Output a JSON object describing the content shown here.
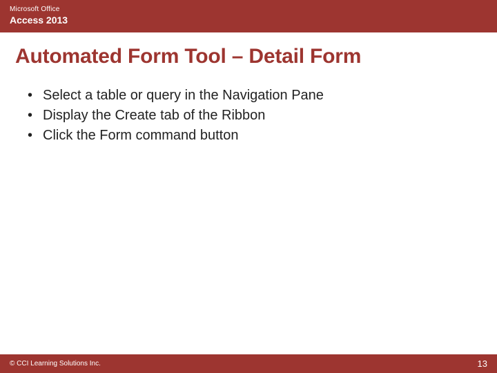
{
  "header": {
    "brand": "Microsoft Office",
    "product": "Access 2013"
  },
  "title": "Automated Form Tool – Detail Form",
  "bullets": [
    "Select a table or query in the Navigation Pane",
    "Display the Create tab of the Ribbon",
    "Click the Form command button"
  ],
  "footer": {
    "copyright": "© CCI Learning Solutions Inc.",
    "page": "13"
  }
}
